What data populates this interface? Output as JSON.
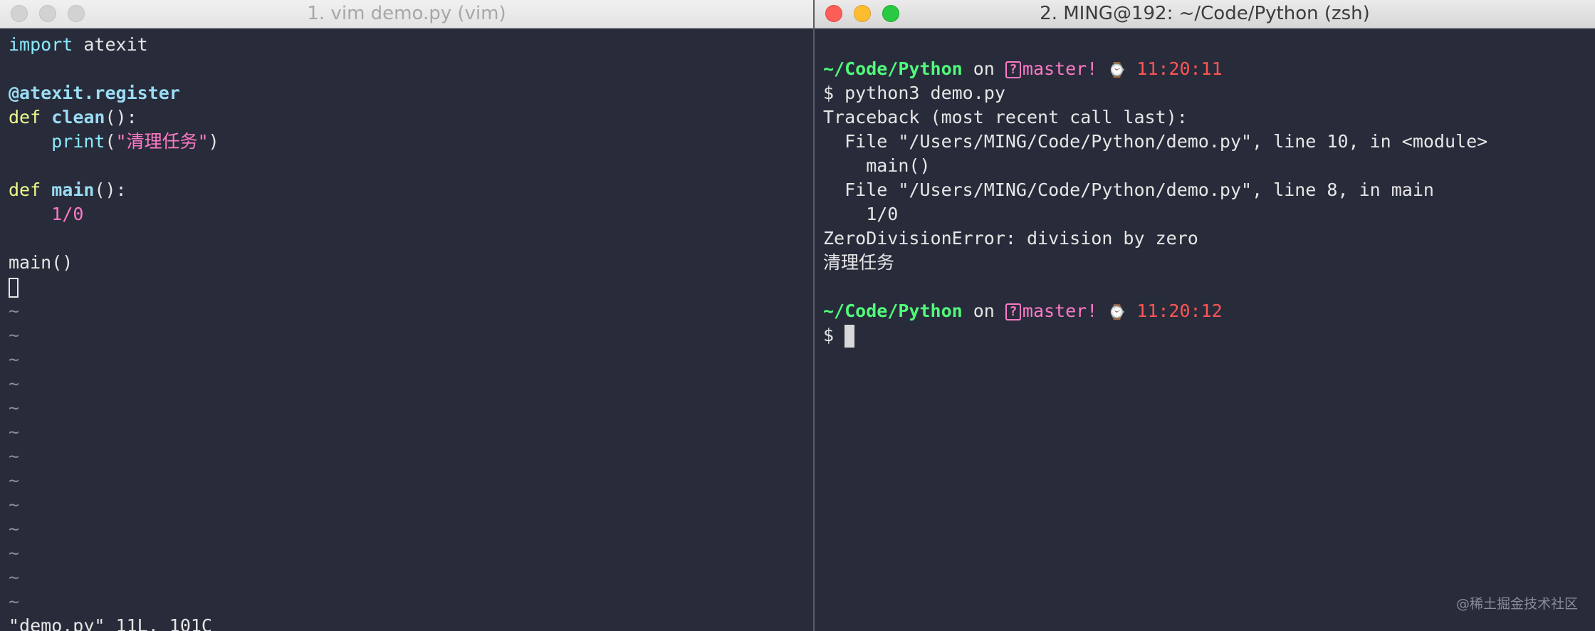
{
  "left_window": {
    "title": "1. vim demo.py (vim)",
    "code": {
      "l1_kw": "import",
      "l1_rest": " atexit",
      "l3_decorator": "@atexit.register",
      "l4_kw": "def",
      "l4_fn": "clean",
      "l4_rest": "():",
      "l5_indent": "    ",
      "l5_builtin": "print",
      "l5_open": "(",
      "l5_str": "\"清理任务\"",
      "l5_close": ")",
      "l7_kw": "def",
      "l7_fn": "main",
      "l7_rest": "():",
      "l8_indent": "    ",
      "l8_num": "1/0",
      "l10_call": "main()",
      "tilde": "~"
    },
    "status_line": "\"demo.py\" 11L, 101C"
  },
  "right_window": {
    "title": "2. MING@192: ~/Code/Python (zsh)",
    "prompt1": {
      "path": "~/Code/Python",
      "on": " on ",
      "branch_icon": "?",
      "branch": "master!",
      "clock_icon": "⌚",
      "time": "11:20:11"
    },
    "output": {
      "cmd": "$ python3 demo.py",
      "tb_header": "Traceback (most recent call last):",
      "tb_file1": "  File \"/Users/MING/Code/Python/demo.py\", line 10, in <module>",
      "tb_code1": "    main()",
      "tb_file2": "  File \"/Users/MING/Code/Python/demo.py\", line 8, in main",
      "tb_code2": "    1/0",
      "error": "ZeroDivisionError: division by zero",
      "printed": "清理任务"
    },
    "prompt2": {
      "path": "~/Code/Python",
      "on": " on ",
      "branch_icon": "?",
      "branch": "master!",
      "clock_icon": "⌚",
      "time": "11:20:12"
    },
    "input_prompt": "$ "
  },
  "watermark": "@稀土掘金技术社区"
}
